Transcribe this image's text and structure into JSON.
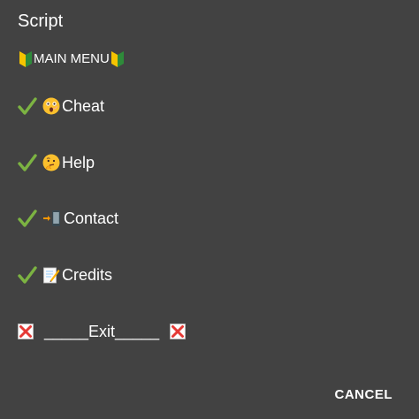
{
  "dialog": {
    "title": "Script",
    "subtitle": "MAIN MENU",
    "items": [
      {
        "label": "Cheat"
      },
      {
        "label": "Help"
      },
      {
        "label": "Contact"
      },
      {
        "label": "Credits"
      }
    ],
    "exit_label": "_____Exit_____",
    "cancel_label": "CANCEL"
  }
}
